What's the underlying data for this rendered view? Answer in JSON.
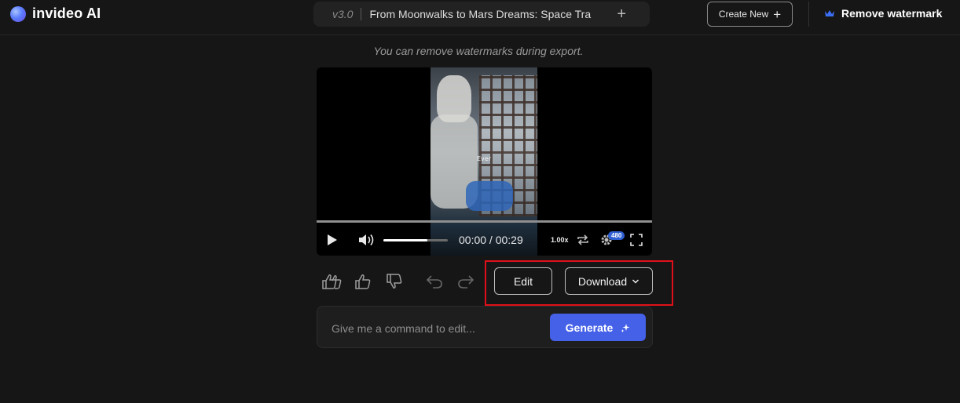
{
  "header": {
    "app_name": "invideo AI",
    "version": "v3.0",
    "project_title": "From Moonwalks to Mars Dreams: Space Tra",
    "create_new_label": "Create New",
    "remove_watermark_label": "Remove watermark"
  },
  "notice": "You can remove watermarks during export.",
  "player": {
    "caption": "Ever",
    "timecode": "00:00 / 00:29",
    "speed": "1.00x",
    "quality": "480",
    "volume_level": 0.68,
    "progress": 0.0
  },
  "actions": {
    "edit_label": "Edit",
    "download_label": "Download"
  },
  "command": {
    "placeholder": "Give me a command to edit...",
    "generate_label": "Generate"
  },
  "icons": {
    "logo": "invideo-logo-icon",
    "title_add": "plus-icon",
    "create_new": "plus-icon",
    "remove_watermark": "crown-icon",
    "play": "play-icon",
    "volume": "volume-icon",
    "loop": "loop-icon",
    "settings": "gear-icon",
    "fullscreen": "fullscreen-icon",
    "love": "love-it-icon",
    "like": "thumbs-up-icon",
    "dislike": "thumbs-down-icon",
    "undo": "undo-icon",
    "redo": "redo-icon",
    "download_chevron": "chevron-down-icon",
    "generate": "sparkle-icon"
  },
  "colors": {
    "background": "#161616",
    "accent": "#4561e8",
    "highlight": "#e0101a",
    "crown": "#3b6ef5"
  }
}
